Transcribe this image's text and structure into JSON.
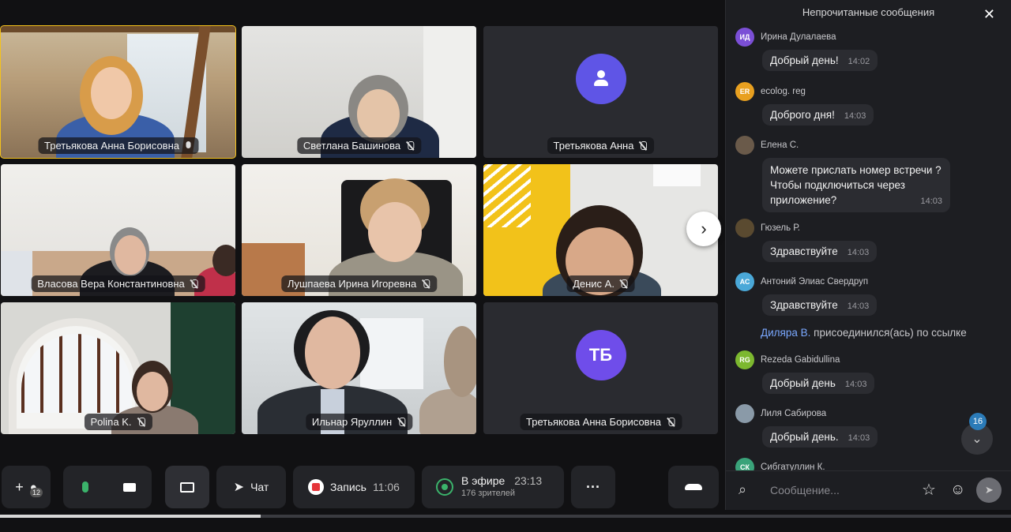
{
  "tiles": [
    {
      "name": "Третьякова Анна Борисовна",
      "mic": "on"
    },
    {
      "name": "Светлана Башинова",
      "mic": "off"
    },
    {
      "name": "Третьякова Анна",
      "mic": "off"
    },
    {
      "name": "Власова Вера Константиновна",
      "mic": "off"
    },
    {
      "name": "Лушпаева Ирина Игоревна",
      "mic": "off"
    },
    {
      "name": "Денис А.",
      "mic": "off"
    },
    {
      "name": "Polina K.",
      "mic": "off"
    },
    {
      "name": "Ильнар Яруллин",
      "mic": "off"
    },
    {
      "name": "Третьякова Анна Борисовна",
      "mic": "off",
      "initials": "ТБ"
    }
  ],
  "toolbar": {
    "participants_badge": "12",
    "chat_label": "Чат",
    "record_label": "Запись",
    "record_time": "11:06",
    "live_label": "В эфире",
    "live_time": "23:13",
    "live_viewers": "176 зрителей",
    "more_label": "···"
  },
  "playback": {
    "progress": 0.258
  },
  "chat": {
    "header": "Непрочитанные сообщения",
    "messages": [
      {
        "initials": "ИД",
        "color": "#7b4fd6",
        "author": "Ирина Дулалаева",
        "text": "Добрый день!",
        "time": "14:02"
      },
      {
        "initials": "ER",
        "color": "#e8a020",
        "author": "ecolog. reg",
        "text": "Доброго дня!",
        "time": "14:03"
      },
      {
        "initials": "",
        "color": "#6a5a4a",
        "author": "Елена С.",
        "text": "Можете прислать номер встречи ? Чтобы подключиться через приложение?",
        "time": "14:03"
      },
      {
        "initials": "",
        "color": "#5a4a30",
        "author": "Гюзель Р.",
        "text": "Здравствуйте",
        "time": "14:03"
      },
      {
        "initials": "АС",
        "color": "#4aa8d8",
        "author": "Антоний Элиас Свердруп",
        "text": "Здравствуйте",
        "time": "14:03"
      },
      {
        "initials": "RG",
        "color": "#7cb82f",
        "author": "Rezeda Gabidullina",
        "text": "Добрый день",
        "time": "14:03"
      },
      {
        "initials": "",
        "color": "#8a9aa8",
        "author": "Лиля Сабирова",
        "text": "Добрый день.",
        "time": "14:03"
      },
      {
        "initials": "СК",
        "color": "#3aa37a",
        "author": "Сибгатуллин К."
      }
    ],
    "joined": {
      "who": "Диляра В.",
      "text": " присоединился(ась) по ссылке"
    },
    "unread_count": "16",
    "composer_placeholder": "Сообщение..."
  }
}
